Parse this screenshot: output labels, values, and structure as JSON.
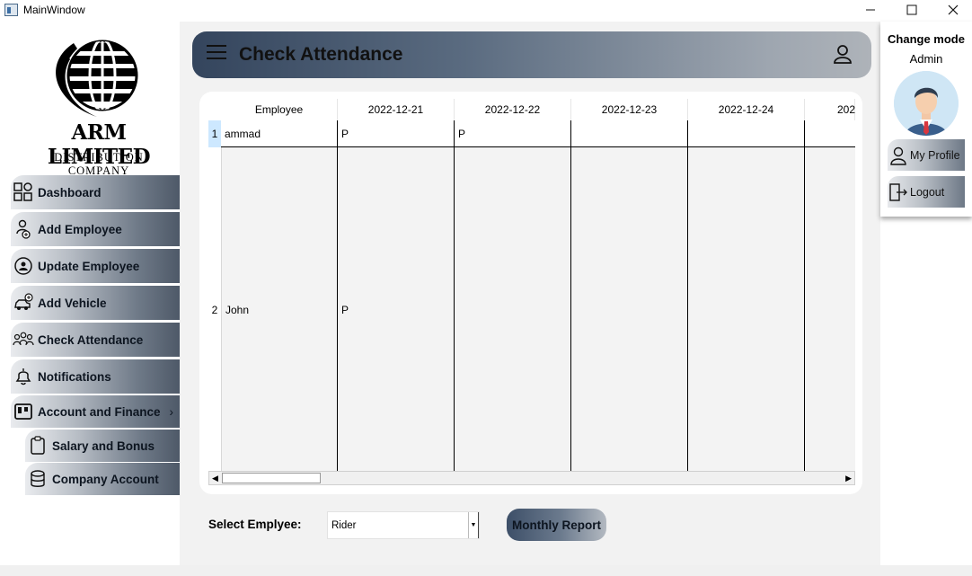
{
  "window": {
    "title": "MainWindow"
  },
  "company": {
    "name": "ARM LIMITED",
    "subtitle": "DISTRIBUTION COMPANY"
  },
  "sidebar": {
    "items": [
      {
        "label": "Dashboard",
        "icon": "dashboard-icon"
      },
      {
        "label": "Add Employee",
        "icon": "add-employee-icon"
      },
      {
        "label": "Update Employee",
        "icon": "update-employee-icon"
      },
      {
        "label": "Add Vehicle",
        "icon": "add-vehicle-icon"
      },
      {
        "label": "Check Attendance",
        "icon": "attendance-icon"
      },
      {
        "label": "Notifications",
        "icon": "bell-icon"
      },
      {
        "label": "Account and Finance",
        "icon": "finance-icon",
        "chevron": "›"
      },
      {
        "label": "Salary and Bonus",
        "icon": "clipboard-icon"
      },
      {
        "label": "Company Account",
        "icon": "database-icon"
      }
    ]
  },
  "header": {
    "title": "Check Attendance"
  },
  "table": {
    "columns": [
      "Employee",
      "2022-12-21",
      "2022-12-22",
      "2022-12-23",
      "2022-12-24",
      "202"
    ],
    "rows": [
      {
        "index": "1",
        "cells": [
          "ammad",
          "P",
          "P",
          "",
          "",
          ""
        ]
      },
      {
        "index": "2",
        "cells": [
          "John",
          "P",
          "",
          "",
          "",
          ""
        ]
      }
    ]
  },
  "filter": {
    "label": "Select Emplyee:",
    "selected": "Rider"
  },
  "actions": {
    "report": "Monthly Report"
  },
  "profile_panel": {
    "mode_label": "Change mode",
    "role": "Admin",
    "my_profile": "My Profile",
    "logout": "Logout"
  },
  "colors": {
    "header_dark": "#34455d",
    "button_dark": "#4e5968",
    "selection": "#cde8ff"
  }
}
